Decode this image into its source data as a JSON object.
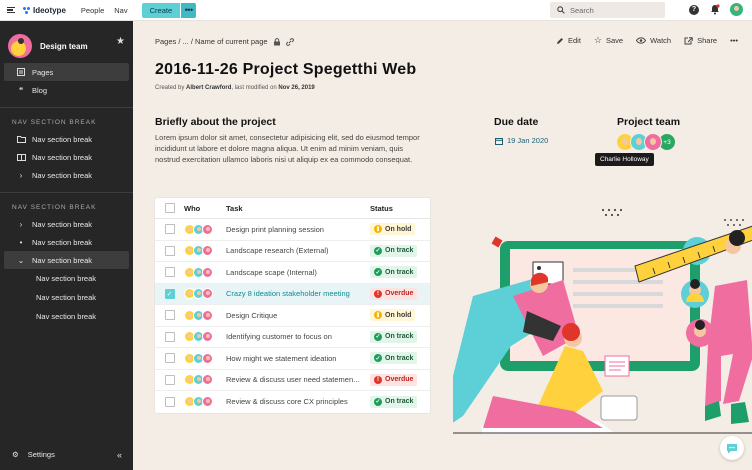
{
  "topbar": {
    "brand": "Ideotype",
    "nav": [
      "People",
      "Nav"
    ],
    "create_label": "Create",
    "more_label": "•••",
    "search_placeholder": "Search",
    "help_label": "?"
  },
  "sidebar": {
    "space_name": "Design team",
    "items": [
      {
        "label": "Pages",
        "icon": "pages-icon"
      },
      {
        "label": "Blog",
        "icon": "quote-icon"
      }
    ],
    "section1": {
      "label": "NAV SECTION BREAK",
      "items": [
        {
          "label": "Nav section break",
          "icon": "folder-icon"
        },
        {
          "label": "Nav section break",
          "icon": "book-icon"
        },
        {
          "label": "Nav section break",
          "icon": "chevron-right-icon"
        }
      ]
    },
    "section2": {
      "label": "NAV SECTION BREAK",
      "items": [
        {
          "label": "Nav section break",
          "icon": "chevron-right-icon"
        },
        {
          "label": "Nav section break",
          "icon": "bullet-icon"
        },
        {
          "label": "Nav section break",
          "icon": "chevron-down-icon"
        }
      ],
      "subitems": [
        "Nav section break",
        "Nav section break",
        "Nav section break"
      ]
    },
    "settings_label": "Settings",
    "collapse_label": "«"
  },
  "page": {
    "breadcrumb": "Pages / ... / Name of current page",
    "actions": {
      "edit": "Edit",
      "save": "Save",
      "watch": "Watch",
      "share": "Share",
      "more": "•••"
    },
    "title": "2016-11-26 Project Spegetthi Web",
    "byline_prefix": "Created by ",
    "author": "Albert Crawford",
    "byline_middle": ", last modified on ",
    "modified": "Nov 26, 2019",
    "about_heading": "Briefly about the project",
    "about_text": "Lorem ipsum dolor sit amet, consectetur adipisicing elit, sed do eiusmod tempor incididunt ut labore et dolore magna aliqua. Ut enim ad minim veniam, quis nostrud exercitation ullamco laboris nisi ut aliquip ex ea commodo consequat.",
    "due_heading": "Due date",
    "due_date": "19 Jan 2020",
    "team_heading": "Project team",
    "team_more": "+3",
    "tooltip": "Charlie Holloway"
  },
  "table": {
    "headers": {
      "who": "Who",
      "task": "Task",
      "status": "Status"
    },
    "rows": [
      {
        "task": "Design print planning session",
        "status": "On hold",
        "kind": "hold",
        "checked": false
      },
      {
        "task": "Landscape research (External)",
        "status": "On track",
        "kind": "track",
        "checked": false
      },
      {
        "task": "Landscape scape (Internal)",
        "status": "On track",
        "kind": "track",
        "checked": false
      },
      {
        "task": "Crazy 8 ideation stakeholder meeting",
        "status": "Overdue",
        "kind": "over",
        "checked": true
      },
      {
        "task": "Design Critique",
        "status": "On hold",
        "kind": "hold",
        "checked": false
      },
      {
        "task": "Identifying customer to focus on",
        "status": "On track",
        "kind": "track",
        "checked": false
      },
      {
        "task": "How might we statement ideation",
        "status": "On track",
        "kind": "track",
        "checked": false
      },
      {
        "task": "Review & discuss user need statemen...",
        "status": "Overdue",
        "kind": "over",
        "checked": false
      },
      {
        "task": "Review & discuss core CX principles",
        "status": "On track",
        "kind": "track",
        "checked": false
      }
    ]
  },
  "colors": {
    "accent": "#5ccfd7",
    "sidebar": "#262626",
    "canvas": "#f4ede6",
    "on_track": "#1e9e58",
    "on_hold": "#f5b400",
    "overdue": "#e0352b"
  }
}
